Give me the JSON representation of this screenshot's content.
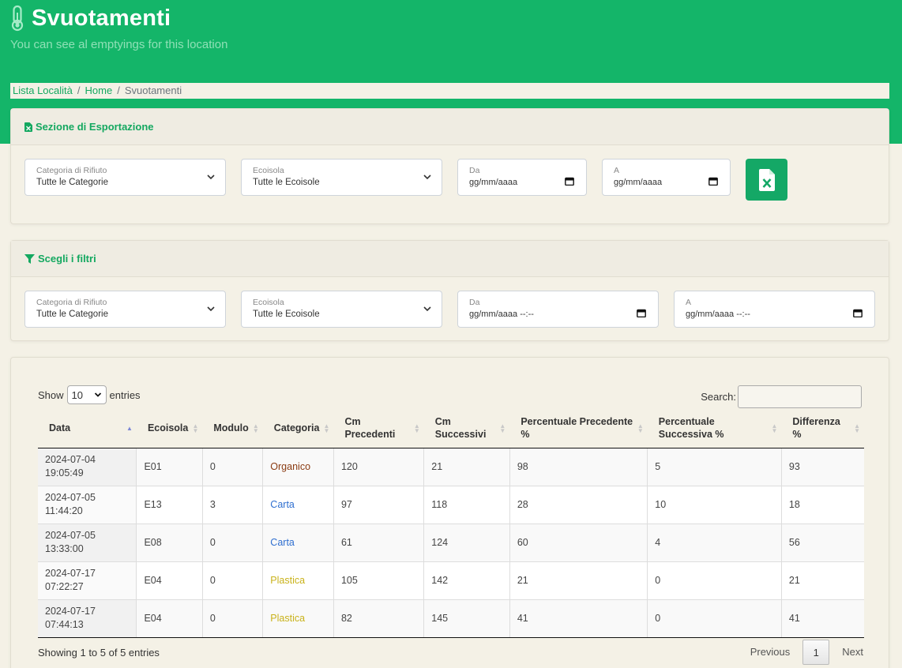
{
  "header": {
    "title": "Svuotamenti",
    "subtitle": "You can see al emptyings for this location"
  },
  "breadcrumb": [
    {
      "label": "Lista Località"
    },
    {
      "label": "Home"
    },
    {
      "label": "Svuotamenti"
    }
  ],
  "export_section": {
    "title": "Sezione di Esportazione",
    "category": {
      "label": "Categoria di Rifiuto",
      "value": "Tutte le Categorie"
    },
    "ecoisola": {
      "label": "Ecoisola",
      "value": "Tutte le Ecoisole"
    },
    "from": {
      "label": "Da",
      "value": "gg/mm/aaaa"
    },
    "to": {
      "label": "A",
      "value": "gg/mm/aaaa"
    },
    "excel_icon": "excel-file-icon"
  },
  "filter_section": {
    "title": "Scegli i filtri",
    "category": {
      "label": "Categoria di Rifiuto",
      "value": "Tutte le Categorie"
    },
    "ecoisola": {
      "label": "Ecoisola",
      "value": "Tutte le Ecoisole"
    },
    "from": {
      "label": "Da",
      "value": "gg/mm/aaaa --:--"
    },
    "to": {
      "label": "A",
      "value": "gg/mm/aaaa --:--"
    }
  },
  "table": {
    "show_label": "Show",
    "entries_label": "entries",
    "page_length": "10",
    "search_label": "Search:",
    "columns": [
      "Data",
      "Ecoisola",
      "Modulo",
      "Categoria",
      "Cm Precedenti",
      "Cm Successivi",
      "Percentuale Precedente %",
      "Percentuale Successiva %",
      "Differenza %"
    ],
    "rows": [
      {
        "data": "2024-07-04 19:05:49",
        "ecoisola": "E01",
        "modulo": "0",
        "categoria": "Organico",
        "cm_prec": "120",
        "cm_succ": "21",
        "perc_prec": "98",
        "perc_succ": "5",
        "diff": "93"
      },
      {
        "data": "2024-07-05 11:44:20",
        "ecoisola": "E13",
        "modulo": "3",
        "categoria": "Carta",
        "cm_prec": "97",
        "cm_succ": "118",
        "perc_prec": "28",
        "perc_succ": "10",
        "diff": "18"
      },
      {
        "data": "2024-07-05 13:33:00",
        "ecoisola": "E08",
        "modulo": "0",
        "categoria": "Carta",
        "cm_prec": "61",
        "cm_succ": "124",
        "perc_prec": "60",
        "perc_succ": "4",
        "diff": "56"
      },
      {
        "data": "2024-07-17 07:22:27",
        "ecoisola": "E04",
        "modulo": "0",
        "categoria": "Plastica",
        "cm_prec": "105",
        "cm_succ": "142",
        "perc_prec": "21",
        "perc_succ": "0",
        "diff": "21"
      },
      {
        "data": "2024-07-17 07:44:13",
        "ecoisola": "E04",
        "modulo": "0",
        "categoria": "Plastica",
        "cm_prec": "82",
        "cm_succ": "145",
        "perc_prec": "41",
        "perc_succ": "0",
        "diff": "41"
      }
    ],
    "info": "Showing 1 to 5 of 5 entries",
    "pagination": {
      "previous": "Previous",
      "current": "1",
      "next": "Next"
    }
  },
  "colors": {
    "brand_green": "#14b569",
    "organico": "#8a3b12",
    "carta": "#2f6fd0",
    "plastica": "#c9b21a"
  }
}
